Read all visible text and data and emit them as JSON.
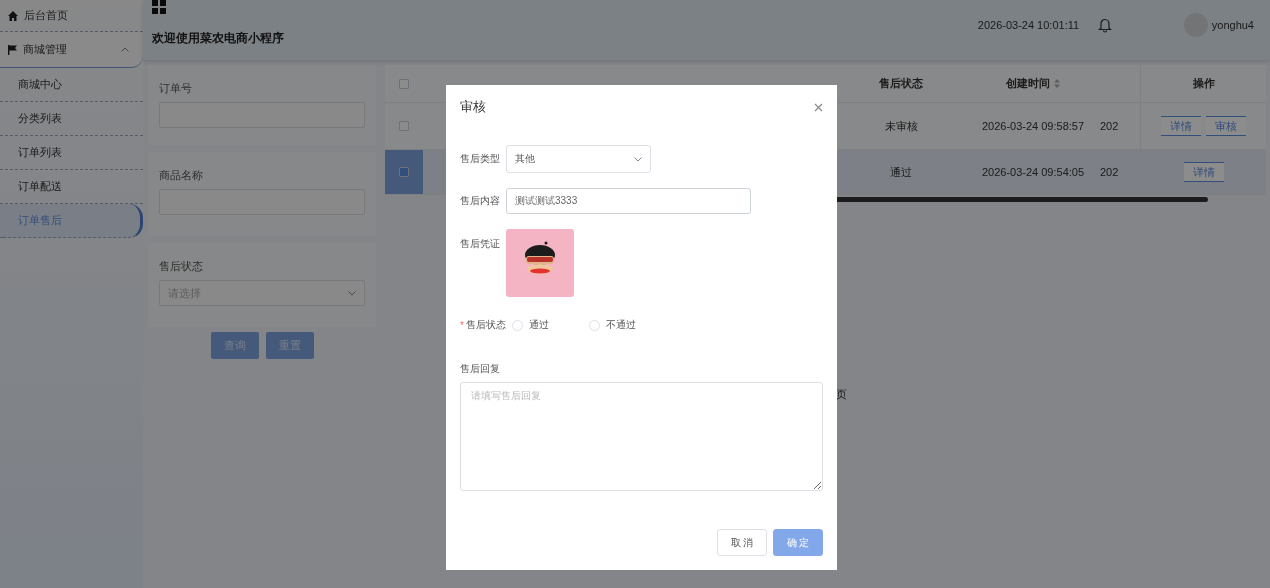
{
  "sidebar": {
    "items": [
      {
        "label": "后台首页",
        "kind": "home",
        "selected": false
      },
      {
        "label": "商城管理",
        "kind": "group",
        "expanded": true,
        "selected": false,
        "children": [
          {
            "label": "商城中心",
            "selected": false
          },
          {
            "label": "分类列表",
            "selected": false
          },
          {
            "label": "订单列表",
            "selected": false
          },
          {
            "label": "订单配送",
            "selected": false
          },
          {
            "label": "订单售后",
            "selected": true
          }
        ]
      }
    ]
  },
  "header": {
    "title": "欢迎使用菜农电商小程序",
    "datetime": "2026-03-24 10:01:11",
    "username": "yonghu4"
  },
  "filters": [
    {
      "label": "订单号",
      "kind": "input"
    },
    {
      "label": "商品名称",
      "kind": "input"
    },
    {
      "label": "售后状态",
      "kind": "select",
      "placeholder": "请选择"
    }
  ],
  "filter_buttons": [
    "查询",
    "重置"
  ],
  "table": {
    "all_selected": false,
    "columns": [
      {
        "label": "售后状态",
        "sortable": false
      },
      {
        "label": "创建时间",
        "sortable": true
      },
      {
        "label": "操作",
        "sortable": false
      }
    ],
    "rows": [
      {
        "selected": false,
        "status": "未审核",
        "created": "2026-03-24 09:58:57",
        "column_5": "202",
        "actions": [
          "详情",
          "审核"
        ]
      },
      {
        "selected": true,
        "status": "通过",
        "created": "2026-03-24 09:54:05",
        "column_5": "202",
        "actions": [
          "详情"
        ]
      }
    ]
  },
  "pagination_fragment": "页",
  "dialog": {
    "title": "审核",
    "type_field": {
      "label": "售后类型",
      "value": "其他"
    },
    "content_field": {
      "label": "售后内容",
      "value": "测试测试3333"
    },
    "proof": {
      "label": "售后凭证",
      "kind": "picture"
    },
    "status": {
      "required_mark": "*",
      "label": "售后状态",
      "options": [
        {
          "label": "通过",
          "selected": false
        },
        {
          "label": "不通过",
          "selected": false
        }
      ]
    },
    "reply": {
      "label": "售后回复",
      "placeholder": "请填写售后回复"
    },
    "buttons": [
      {
        "label": "取 消",
        "kind": "default"
      },
      {
        "label": "确 定",
        "kind": "primary"
      }
    ]
  }
}
